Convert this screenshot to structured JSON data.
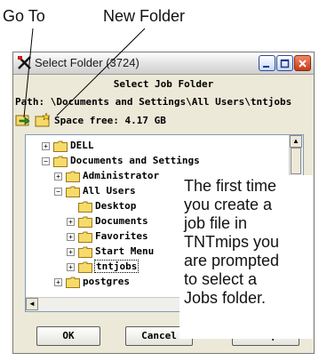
{
  "callouts": {
    "goto_label": "Go To",
    "newfolder_label": "New Folder"
  },
  "window": {
    "title": "Select Folder (3724)",
    "heading": "Select Job Folder",
    "path_label": "Path:",
    "path_value": "\\Documents and Settings\\All Users\\tntjobs",
    "space_free": "Space free:  4.17 GB"
  },
  "tree": {
    "items": [
      {
        "label": "DELL",
        "expander": "+"
      },
      {
        "label": "Documents and Settings",
        "expander": "−"
      },
      {
        "label": "Administrator",
        "expander": "+"
      },
      {
        "label": "All Users",
        "expander": "−"
      },
      {
        "label": "Desktop",
        "expander": ""
      },
      {
        "label": "Documents",
        "expander": "+"
      },
      {
        "label": "Favorites",
        "expander": "+"
      },
      {
        "label": "Start Menu",
        "expander": "+"
      },
      {
        "label": "tntjobs",
        "expander": "+",
        "selected": true
      },
      {
        "label": "postgres",
        "expander": "+"
      }
    ]
  },
  "buttons": {
    "ok": "OK",
    "cancel": "Cancel",
    "help": "Help"
  },
  "annotation": {
    "lines": [
      "The first time",
      "you create a",
      "job file in",
      "TNTmips you",
      "are prompted",
      "to select a",
      "Jobs folder."
    ]
  },
  "colors": {
    "window_bg": "#ece9d8",
    "close_button": "#d8542a",
    "folder_fill": "#f6da6a",
    "tree_border": "#7f9db9"
  },
  "icons": {
    "goto": "goto-arrow-icon",
    "new_folder": "new-folder-icon",
    "folder": "folder-icon",
    "minimize": "minimize-icon",
    "maximize": "maximize-icon",
    "close": "close-icon"
  }
}
